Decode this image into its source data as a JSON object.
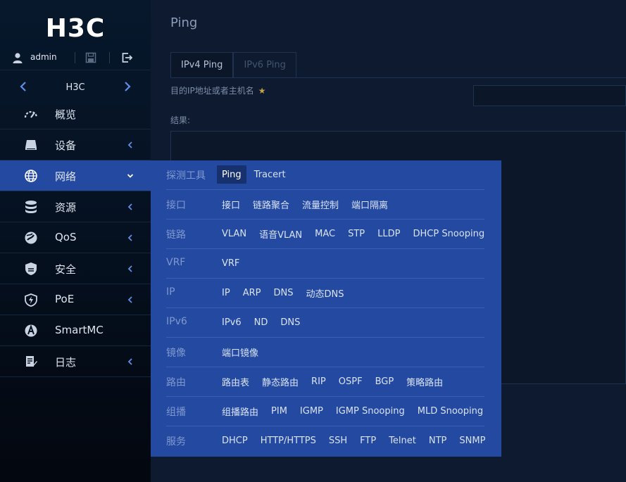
{
  "sidebar": {
    "logo": "H3C",
    "username": "admin",
    "device_name": "H3C",
    "nav": [
      {
        "label": "概览",
        "icon": "gauge-icon",
        "has_chevron": false,
        "chev": ""
      },
      {
        "label": "设备",
        "icon": "device-icon",
        "has_chevron": true,
        "chev": "left"
      },
      {
        "label": "网络",
        "icon": "globe-icon",
        "has_chevron": true,
        "chev": "down"
      },
      {
        "label": "资源",
        "icon": "database-icon",
        "has_chevron": true,
        "chev": "left"
      },
      {
        "label": "QoS",
        "icon": "qos-icon",
        "has_chevron": true,
        "chev": "left"
      },
      {
        "label": "安全",
        "icon": "shield-icon",
        "has_chevron": true,
        "chev": "left"
      },
      {
        "label": "PoE",
        "icon": "power-shield-icon",
        "has_chevron": true,
        "chev": "left"
      },
      {
        "label": "SmartMC",
        "icon": "smartmc-icon",
        "has_chevron": false,
        "chev": ""
      },
      {
        "label": "日志",
        "icon": "log-icon",
        "has_chevron": true,
        "chev": "left"
      }
    ],
    "active_index": 2
  },
  "main": {
    "title": "Ping",
    "tabs": [
      {
        "label": "IPv4 Ping",
        "active": true
      },
      {
        "label": "IPv6 Ping",
        "active": false
      }
    ],
    "target_label": "目的IP地址或者主机名",
    "required_mark": "★",
    "result_label": "结果:"
  },
  "megamenu": {
    "rows": [
      {
        "category": "探测工具",
        "links": [
          "Ping",
          "Tracert"
        ],
        "selected": "Ping"
      },
      {
        "category": "接口",
        "links": [
          "接口",
          "链路聚合",
          "流量控制",
          "端口隔离"
        ]
      },
      {
        "category": "链路",
        "links": [
          "VLAN",
          "语音VLAN",
          "MAC",
          "STP",
          "LLDP",
          "DHCP Snooping"
        ]
      },
      {
        "category": "VRF",
        "links": [
          "VRF"
        ]
      },
      {
        "category": "IP",
        "links": [
          "IP",
          "ARP",
          "DNS",
          "动态DNS"
        ]
      },
      {
        "category": "IPv6",
        "links": [
          "IPv6",
          "ND",
          "DNS"
        ]
      },
      {
        "category": "镜像",
        "links": [
          "端口镜像"
        ]
      },
      {
        "category": "路由",
        "links": [
          "路由表",
          "静态路由",
          "RIP",
          "OSPF",
          "BGP",
          "策略路由"
        ]
      },
      {
        "category": "组播",
        "links": [
          "组播路由",
          "PIM",
          "IGMP",
          "IGMP Snooping",
          "MLD Snooping"
        ]
      },
      {
        "category": "服务",
        "links": [
          "DHCP",
          "HTTP/HTTPS",
          "SSH",
          "FTP",
          "Telnet",
          "NTP",
          "SNMP"
        ]
      }
    ]
  },
  "colors": {
    "accent": "#2449a0",
    "sidebar_bg": "#051121",
    "main_bg": "#0e1a2f",
    "selected_link_bg": "#16316e"
  }
}
